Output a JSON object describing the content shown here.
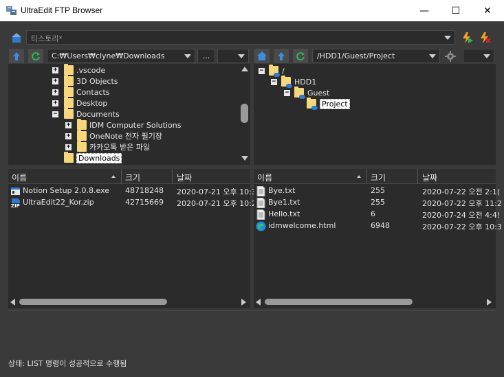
{
  "window": {
    "title": "UltraEdit FTP Browser",
    "min_glyph": "—",
    "max_glyph": "☐",
    "close_glyph": "✕"
  },
  "history": {
    "placeholder": "티스토리*"
  },
  "local": {
    "path": "C:₩Users₩clyne₩Downloads",
    "browse_label": "...",
    "tree": [
      {
        "label": ".vscode",
        "expander": "+"
      },
      {
        "label": "3D Objects",
        "expander": "+"
      },
      {
        "label": "Contacts",
        "expander": "+"
      },
      {
        "label": "Desktop",
        "expander": "+"
      },
      {
        "label": "Documents",
        "expander": "−"
      },
      {
        "label": "IDM Computer Solutions",
        "expander": "+"
      },
      {
        "label": "OneNote 전자 필기장",
        "expander": "+"
      },
      {
        "label": "카카오톡 받은 파일",
        "expander": "+"
      },
      {
        "label": "Downloads",
        "expander": ""
      }
    ],
    "columns": {
      "name": "이름",
      "size": "크기",
      "date": "날짜"
    },
    "files": [
      {
        "name": "Notion Setup 2.0.8.exe",
        "size": "48718248",
        "date": "2020-07-21 오후 10:3",
        "icon": "exe-icon"
      },
      {
        "name": "UltraEdit22_Kor.zip",
        "size": "42715669",
        "date": "2020-07-21 오후 10:2",
        "icon": "zip-icon"
      }
    ]
  },
  "remote": {
    "path": "/HDD1/Guest/Project",
    "tree": [
      {
        "label": "/",
        "expander": "−"
      },
      {
        "label": "HDD1",
        "expander": "−"
      },
      {
        "label": "Guest",
        "expander": "−"
      },
      {
        "label": "Project",
        "expander": ""
      }
    ],
    "columns": {
      "name": "이름",
      "size": "크기",
      "date": "날짜"
    },
    "files": [
      {
        "name": "Bye.txt",
        "size": "255",
        "date": "2020-07-22 오전 2:1(",
        "icon": "text-file-icon"
      },
      {
        "name": "Bye1.txt",
        "size": "255",
        "date": "2020-07-22 오후 11:2",
        "icon": "text-file-icon"
      },
      {
        "name": "Hello.txt",
        "size": "6",
        "date": "2020-07-24 오전 4:4!",
        "icon": "text-file-icon"
      },
      {
        "name": "idmwelcome.html",
        "size": "6948",
        "date": "2020-07-22 오후 10:3",
        "icon": "edge-html-icon"
      }
    ]
  },
  "status": {
    "text": "상태: LIST 명령이 성공적으로 수행됨"
  },
  "colors": {
    "accent": "#1e73d6",
    "background": "#3a3a3a",
    "panel": "#2b2b2b",
    "refresh": "#2db84d",
    "folder": "#f6d77a"
  }
}
